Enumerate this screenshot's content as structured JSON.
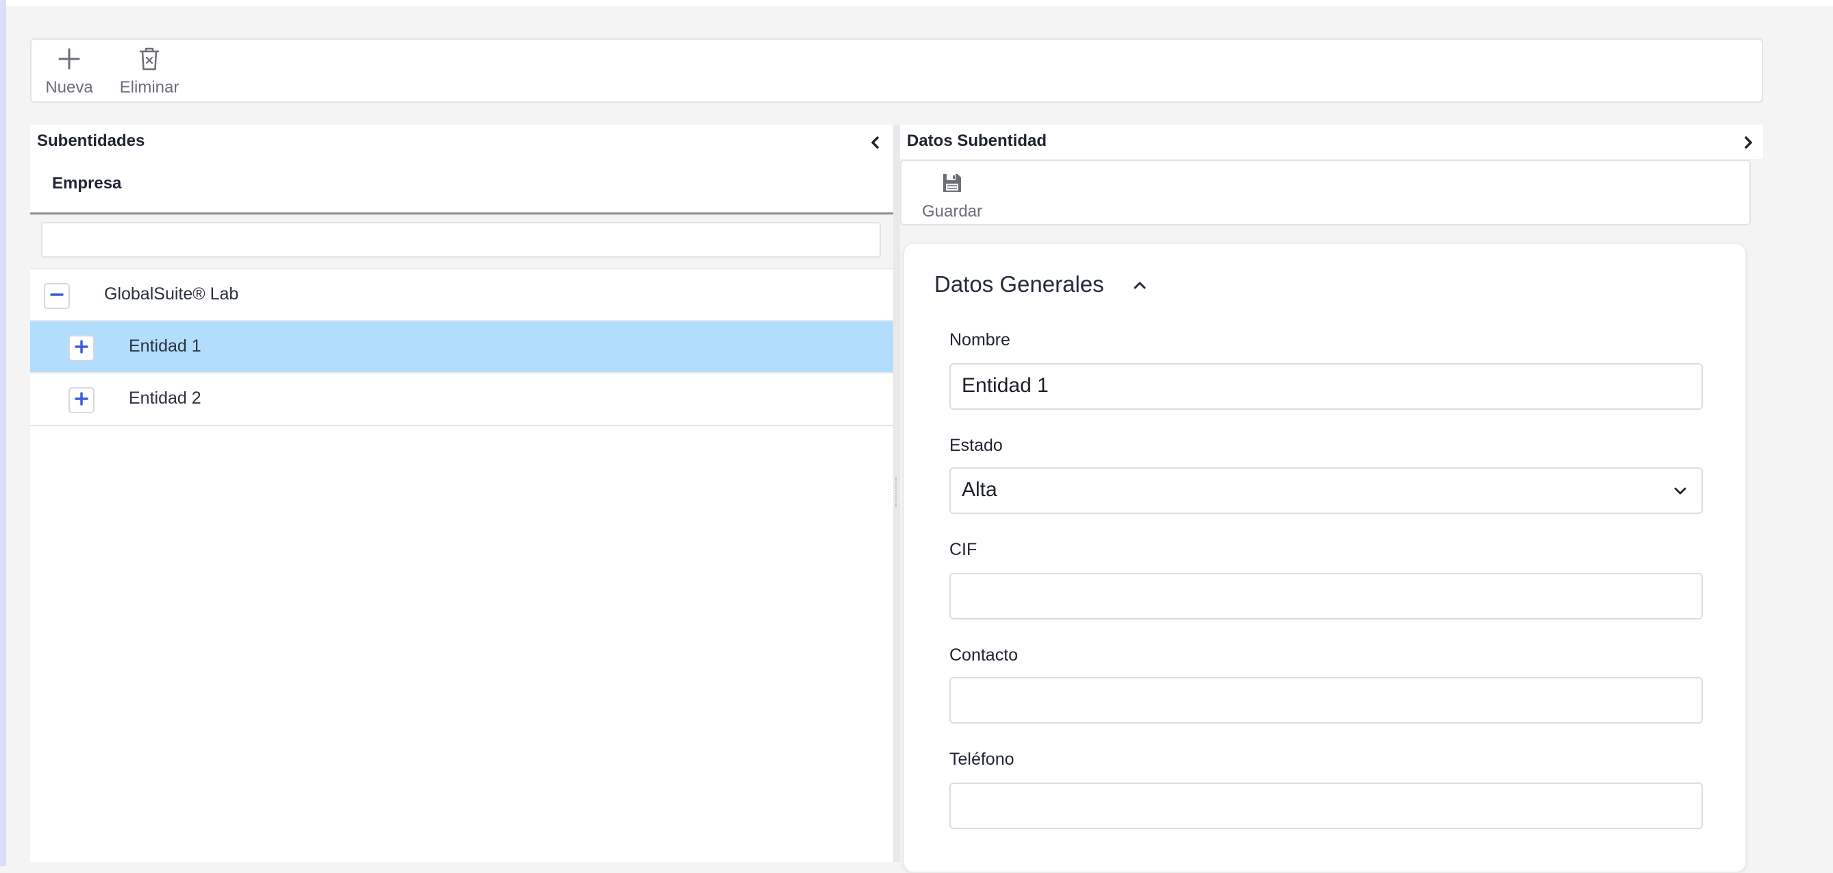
{
  "toolbar": {
    "new_label": "Nueva",
    "delete_label": "Eliminar"
  },
  "left_panel": {
    "title": "Subentidades",
    "tab_label": "Empresa",
    "filter_placeholder": "",
    "tree": [
      {
        "label": "GlobalSuite® Lab",
        "toggle": "collapse",
        "selected": false
      },
      {
        "label": "Entidad 1",
        "toggle": "expand",
        "selected": true
      },
      {
        "label": "Entidad 2",
        "toggle": "expand",
        "selected": false
      }
    ]
  },
  "right_panel": {
    "title": "Datos Subentidad",
    "save_label": "Guardar",
    "section_title": "Datos Generales",
    "fields": {
      "nombre_label": "Nombre",
      "nombre_value": "Entidad 1",
      "estado_label": "Estado",
      "estado_value": "Alta",
      "cif_label": "CIF",
      "cif_value": "",
      "contacto_label": "Contacto",
      "contacto_value": "",
      "telefono_label": "Teléfono",
      "telefono_value": ""
    }
  },
  "colors": {
    "accent": "#3b5bdb",
    "selected_row": "#b3ddfd",
    "icon_gray": "#6b6e78"
  }
}
